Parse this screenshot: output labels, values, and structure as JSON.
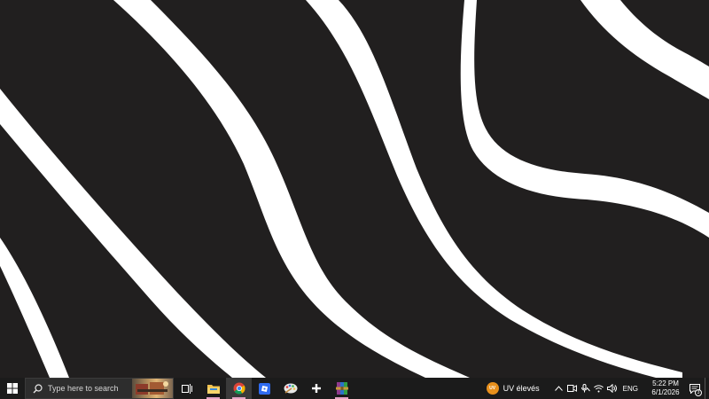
{
  "colors": {
    "wallpaper_bg": "#211f1f",
    "wallpaper_stripe": "#ffffff",
    "taskbar_bg": "#1b1b1b",
    "running_indicator": "#e5a4c6",
    "uv_badge": "#e8901c"
  },
  "taskbar": {
    "start_icon": "windows-logo-icon",
    "search": {
      "placeholder": "Type here to search",
      "icon": "search-icon"
    },
    "task_view_icon": "task-view-icon",
    "apps": [
      {
        "name": "File Explorer",
        "icon": "folder-icon",
        "running": true
      },
      {
        "name": "Google Chrome",
        "icon": "chrome-icon",
        "running": true,
        "active": true
      },
      {
        "name": "Roblox",
        "icon": "roblox-icon",
        "running": false
      },
      {
        "name": "Paint",
        "icon": "paint-palette-icon",
        "running": false
      },
      {
        "name": "App",
        "icon": "plus-app-icon",
        "running": false
      },
      {
        "name": "WinRAR",
        "icon": "winrar-icon",
        "running": true
      }
    ],
    "weather": {
      "badge": "UV",
      "text": "UV élevés"
    },
    "tray": {
      "chevron_icon": "chevron-up-icon",
      "language": "ENG"
    },
    "clock": {
      "time": "5:22 PM",
      "date": "6/1/2026"
    },
    "notifications": {
      "count": "3"
    }
  }
}
